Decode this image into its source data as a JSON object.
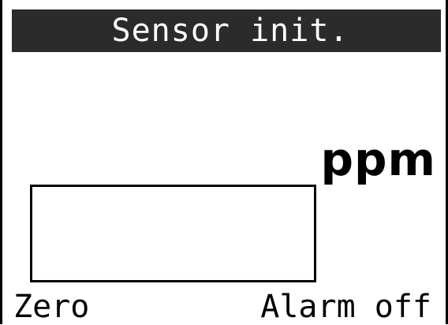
{
  "screen": {
    "title": "Sensor init.",
    "unit": "ppm"
  },
  "softkeys": {
    "left_label": "Zero",
    "right_label": "Alarm off"
  },
  "colors": {
    "title_bar_bg": "#2b2b2b",
    "title_text": "#ffffff",
    "foreground": "#000000",
    "background": "#ffffff"
  }
}
